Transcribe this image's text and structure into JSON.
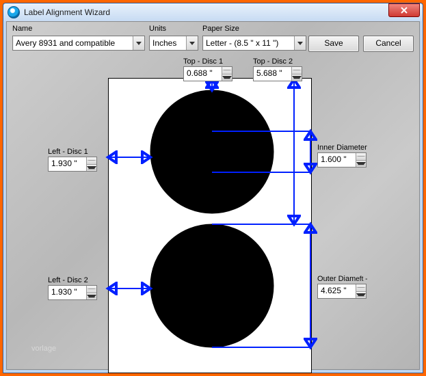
{
  "window": {
    "title": "Label Alignment Wizard"
  },
  "form": {
    "name_label": "Name",
    "name_value": "Avery 8931 and compatible",
    "units_label": "Units",
    "units_value": "Inches",
    "paper_label": "Paper Size",
    "paper_value": "Letter - (8.5 \" x 11 \")",
    "save_label": "Save",
    "cancel_label": "Cancel"
  },
  "fields": {
    "top_disc1": {
      "label": "Top - Disc 1",
      "value": "0.688 \""
    },
    "top_disc2": {
      "label": "Top - Disc 2",
      "value": "5.688 \""
    },
    "left_disc1": {
      "label": "Left - Disc 1",
      "value": "1.930 \""
    },
    "left_disc2": {
      "label": "Left - Disc 2",
      "value": "1.930 \""
    },
    "inner_diam": {
      "label": "Inner Diameter",
      "value": "1.600 \""
    },
    "outer_diam": {
      "label": "Outer Diam",
      "sublabel": "eft -",
      "value": "4.625 \""
    }
  },
  "watermark": "vorlage",
  "colors": {
    "accent": "#0020ff"
  }
}
